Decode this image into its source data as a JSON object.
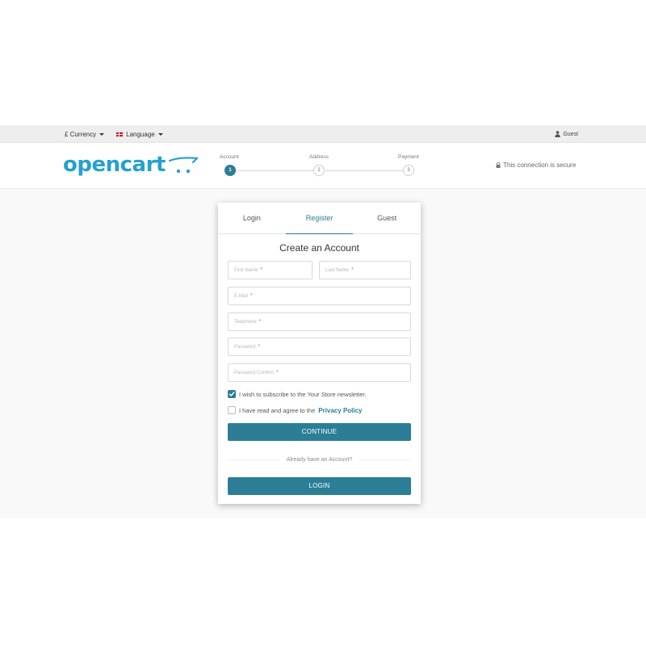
{
  "topbar": {
    "currency_label": "£ Currency",
    "language_label": "Language",
    "user_label": "Guest"
  },
  "header": {
    "logo_text": "opencart",
    "secure_text": "This connection is secure",
    "steps": [
      {
        "label": "Account",
        "number": "1",
        "active": true
      },
      {
        "label": "Address",
        "number": "2",
        "active": false
      },
      {
        "label": "Payment",
        "number": "3",
        "active": false
      }
    ]
  },
  "card": {
    "tabs": [
      {
        "label": "Login",
        "active": false
      },
      {
        "label": "Register",
        "active": true
      },
      {
        "label": "Guest",
        "active": false
      }
    ],
    "title": "Create an Account",
    "fields": {
      "first_name": "First Name",
      "last_name": "Last Name",
      "email": "E-Mail",
      "telephone": "Telephone",
      "password": "Password",
      "password_confirm": "Password Confirm"
    },
    "required_marker": "*",
    "newsletter_label": "I wish to subscribe to the Your Store newsletter.",
    "newsletter_checked": true,
    "agree_prefix": "I have read and agree to the",
    "agree_link": "Privacy Policy",
    "agree_checked": false,
    "continue_label": "CONTINUE",
    "already_text": "Already have an Account?",
    "login_label": "LOGIN"
  },
  "colors": {
    "accent": "#2b7e96",
    "logo": "#23a1d1"
  }
}
